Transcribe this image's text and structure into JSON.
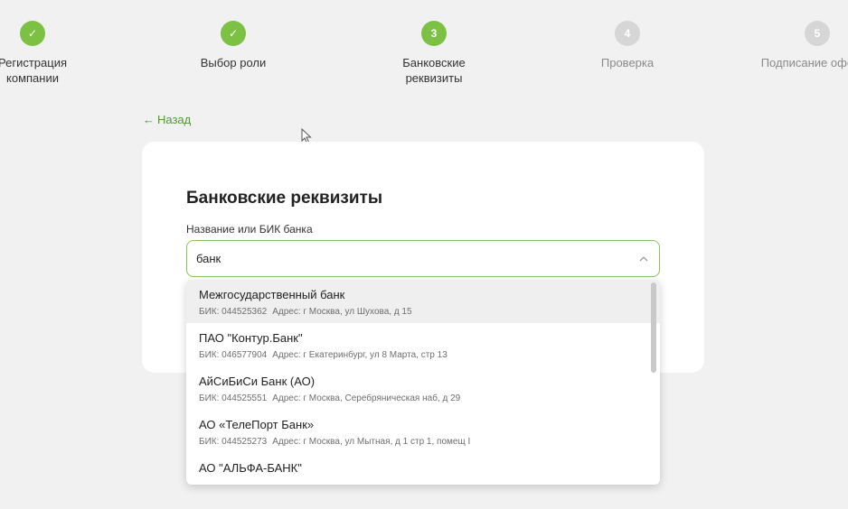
{
  "stepper": {
    "steps": [
      {
        "label": "Регистрация компании",
        "state": "done",
        "marker": "✓"
      },
      {
        "label": "Выбор роли",
        "state": "done",
        "marker": "✓"
      },
      {
        "label": "Банковские реквизиты",
        "state": "active",
        "marker": "3"
      },
      {
        "label": "Проверка",
        "state": "todo",
        "marker": "4"
      },
      {
        "label": "Подписание оферты",
        "state": "todo",
        "marker": "5"
      }
    ]
  },
  "back_link": {
    "arrow": "←",
    "label": "Назад"
  },
  "form": {
    "title": "Банковские реквизиты",
    "bank_field": {
      "label": "Название или БИК банка",
      "value": "банк"
    }
  },
  "dropdown": {
    "options": [
      {
        "name": "Межгосударственный банк",
        "bik": "БИК: 044525362",
        "address": "Адрес: г Москва, ул Шухова, д 15"
      },
      {
        "name": "ПАО \"Контур.Банк\"",
        "bik": "БИК: 046577904",
        "address": "Адрес: г Екатеринбург, ул 8 Марта, стр 13"
      },
      {
        "name": "АйСиБиСи Банк (АО)",
        "bik": "БИК: 044525551",
        "address": "Адрес: г Москва, Серебряническая наб, д 29"
      },
      {
        "name": "АО «ТелеПорт Банк»",
        "bik": "БИК: 044525273",
        "address": "Адрес: г Москва, ул Мытная, д 1 стр 1, помещ I"
      },
      {
        "name": "АО \"АЛЬФА-БАНК\"",
        "bik": "",
        "address": ""
      }
    ]
  },
  "colors": {
    "accent": "#7cc144",
    "link": "#4f9b32",
    "inactive": "#d6d6d6"
  }
}
